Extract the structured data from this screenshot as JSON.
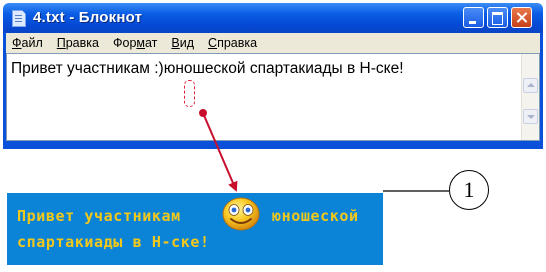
{
  "window": {
    "title": "4.txt - Блокнот"
  },
  "menu": [
    {
      "underline": "Ф",
      "rest": "айл"
    },
    {
      "underline": "П",
      "rest": "равка"
    },
    {
      "pre": "Фор",
      "underline": "м",
      "rest": "ат"
    },
    {
      "underline": "В",
      "rest": "ид"
    },
    {
      "underline": "С",
      "rest": "правка"
    }
  ],
  "editor": {
    "before": "Привет участникам ",
    "smiley": ":)",
    "after": "юношеской спартакиады в Н-ске!"
  },
  "banner": {
    "line1_left": "Привет участникам",
    "line1_right": "юношеской",
    "line2": "спартакиады в Н-ске!",
    "text_color": "#f2c81a",
    "background": "#0b84d8"
  },
  "callout": {
    "number": "1"
  },
  "colors": {
    "arrow": "#c8102e",
    "marker": "#e0203a"
  }
}
